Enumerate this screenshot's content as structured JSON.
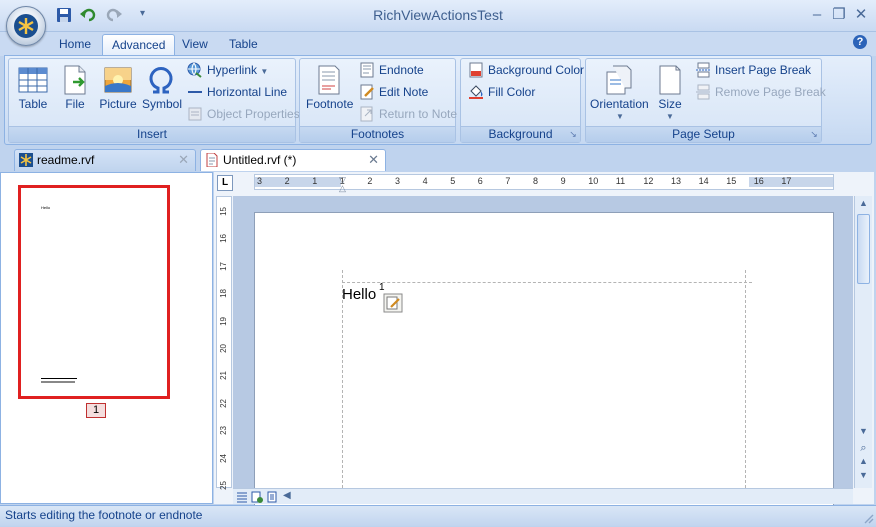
{
  "window": {
    "title": "RichViewActionsTest"
  },
  "ribbon_tabs": [
    {
      "label": "Home",
      "active": false
    },
    {
      "label": "Advanced",
      "active": true
    },
    {
      "label": "View",
      "active": false
    },
    {
      "label": "Table",
      "active": false
    }
  ],
  "groups": {
    "insert": {
      "label": "Insert",
      "table": "Table",
      "file": "File",
      "picture": "Picture",
      "symbol": "Symbol",
      "hyperlink": "Hyperlink",
      "horizontal_line": "Horizontal Line",
      "object_properties": "Object Properties"
    },
    "footnotes": {
      "label": "Footnotes",
      "footnote": "Footnote",
      "endnote": "Endnote",
      "edit_note": "Edit Note",
      "return_to_note": "Return to Note"
    },
    "background": {
      "label": "Background",
      "background_color": "Background Color",
      "fill_color": "Fill Color"
    },
    "page_setup": {
      "label": "Page Setup",
      "orientation": "Orientation",
      "size": "Size",
      "insert_page_break": "Insert Page Break",
      "remove_page_break": "Remove Page Break"
    }
  },
  "doc_tabs": [
    {
      "label": "readme.rvf",
      "active": false
    },
    {
      "label": "Untitled.rvf (*)",
      "active": true
    }
  ],
  "thumbnails": {
    "page_number": "1",
    "thumb_text": "Hello"
  },
  "ruler": {
    "corner": "L",
    "h_ticks": [
      "3",
      "2",
      "1",
      "1",
      "2",
      "3",
      "4",
      "5",
      "6",
      "7",
      "8",
      "9",
      "10",
      "11",
      "12",
      "13",
      "14",
      "15",
      "16",
      "17"
    ],
    "v_ticks": [
      "15",
      "16",
      "17",
      "18",
      "19",
      "20",
      "21",
      "22",
      "23",
      "24",
      "25"
    ]
  },
  "document": {
    "text": "Hello",
    "note_ref": "1"
  },
  "status": {
    "text": "Starts editing the footnote or endnote"
  },
  "colors": {
    "accent": "#15428b",
    "selection_border": "#e02020"
  }
}
